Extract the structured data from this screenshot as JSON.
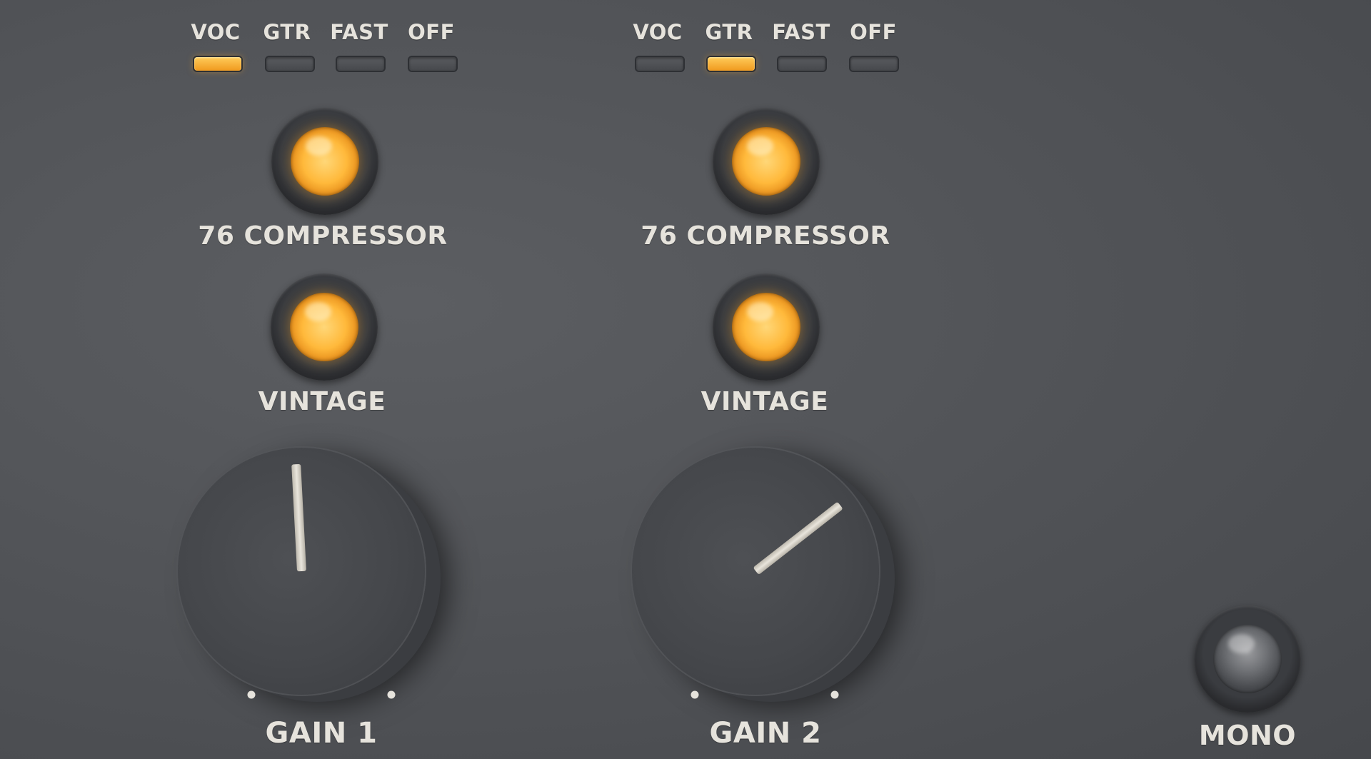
{
  "channel_1": {
    "mode_labels": [
      "VOC",
      "GTR",
      "FAST",
      "OFF"
    ],
    "selected_mode": "VOC",
    "compressor_label": "76 COMPRESSOR",
    "compressor_on": true,
    "vintage_label": "VINTAGE",
    "vintage_on": true,
    "gain_label": "GAIN 1",
    "gain_pointer_angle_deg": -3
  },
  "channel_2": {
    "mode_labels": [
      "VOC",
      "GTR",
      "FAST",
      "OFF"
    ],
    "selected_mode": "GTR",
    "compressor_label": "76 COMPRESSOR",
    "compressor_on": true,
    "vintage_label": "VINTAGE",
    "vintage_on": true,
    "gain_label": "GAIN 2",
    "gain_pointer_angle_deg": 52
  },
  "mono": {
    "label": "MONO",
    "on": false
  },
  "colors": {
    "led_on": "#f4a62a",
    "label": "#e6e3dc",
    "panel": "#505256"
  }
}
